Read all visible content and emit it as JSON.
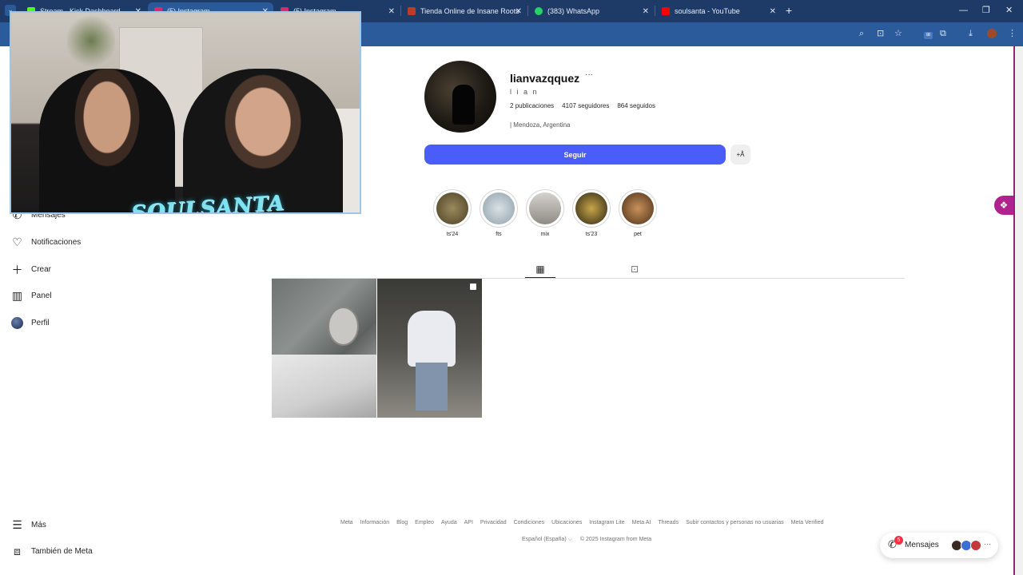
{
  "browser": {
    "tabs": [
      {
        "title": "Stream - Kick Dashboard",
        "favicon_color": "#53fc18",
        "active": false
      },
      {
        "title": "(5) Instagram",
        "favicon_color": "#d62976",
        "active": true
      },
      {
        "title": "(5) Instagram",
        "favicon_color": "#d62976",
        "active": false
      },
      {
        "title": "Tienda Online de Insane Roots",
        "favicon_color": "#c0392b",
        "active": false
      },
      {
        "title": "(383) WhatsApp",
        "favicon_color": "#25d366",
        "active": false
      },
      {
        "title": "soulsanta - YouTube",
        "favicon_color": "#ff0000",
        "active": false
      }
    ],
    "new_tab": "+"
  },
  "sidebar": {
    "items": [
      {
        "label": "Mensajes",
        "icon": "messenger-icon"
      },
      {
        "label": "Notificaciones",
        "icon": "heart-icon"
      },
      {
        "label": "Crear",
        "icon": "plus-icon"
      },
      {
        "label": "Panel",
        "icon": "chart-icon"
      },
      {
        "label": "Perfil",
        "icon": "avatar-icon"
      }
    ],
    "more": "Más",
    "meta": "También de Meta"
  },
  "stream": {
    "logo_text": "SOULSANTA"
  },
  "profile": {
    "username": "lianvazqquez",
    "more": "···",
    "full_name": "l i a n",
    "posts": "2",
    "posts_label": "publicaciones",
    "followers": "4107",
    "followers_label": "seguidores",
    "following": "864",
    "following_label": "seguidos",
    "bio": "| Mendoza, Argentina",
    "follow_button": "Seguir",
    "suggest_button": "+Å"
  },
  "highlights": [
    {
      "label": "ts'24",
      "color": "#7a6a3e"
    },
    {
      "label": "fts",
      "color": "#b9c4cc"
    },
    {
      "label": "mix",
      "color": "#a9a6a0"
    },
    {
      "label": "ts'23",
      "color": "#4b4127"
    },
    {
      "label": "pet",
      "color": "#9a6a3a"
    }
  ],
  "footer": {
    "links": [
      "Meta",
      "Información",
      "Blog",
      "Empleo",
      "Ayuda",
      "API",
      "Privacidad",
      "Condiciones",
      "Ubicaciones",
      "Instagram Lite",
      "Meta AI",
      "Threads",
      "Subir contactos y personas no usuarias",
      "Meta Verified"
    ],
    "language": "Español (España) ⌵",
    "copyright": "© 2025 Instagram from Meta"
  },
  "messages_pill": {
    "label": "Mensajes",
    "badge": "5",
    "more": "···"
  },
  "colors": {
    "follow_button": "#4a5df9",
    "browser_tabbar": "#1e3a66",
    "browser_toolbar": "#2c5b9c"
  }
}
